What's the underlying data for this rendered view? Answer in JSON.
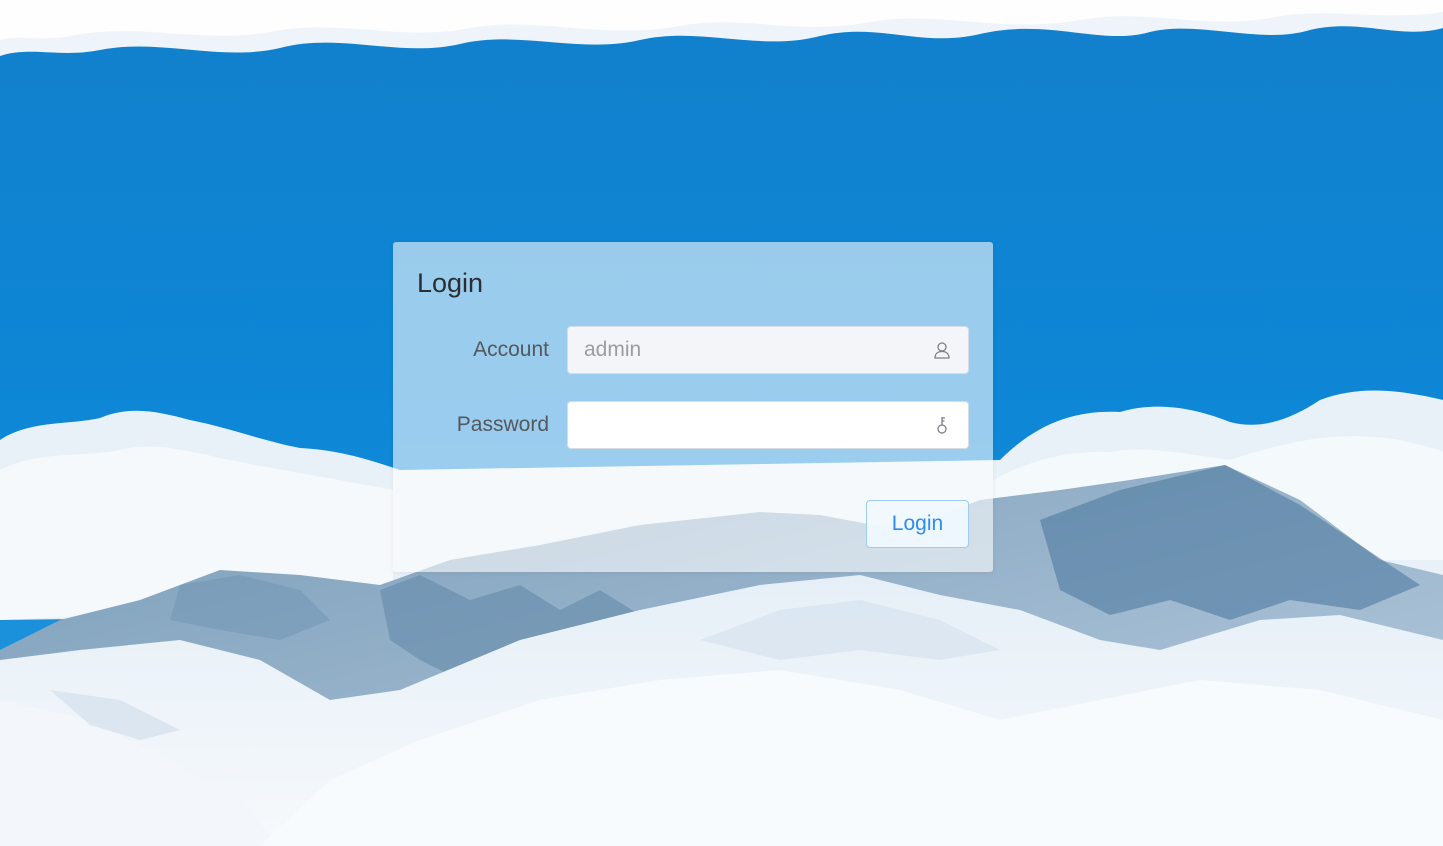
{
  "login": {
    "title": "Login",
    "account": {
      "label": "Account",
      "value": "admin",
      "icon": "user-icon"
    },
    "password": {
      "label": "Password",
      "value": "",
      "icon": "key-icon"
    },
    "submit_label": "Login"
  },
  "colors": {
    "sky": "#0f86d4",
    "button_text": "#2d8cf0",
    "button_border": "#9ecbee"
  }
}
